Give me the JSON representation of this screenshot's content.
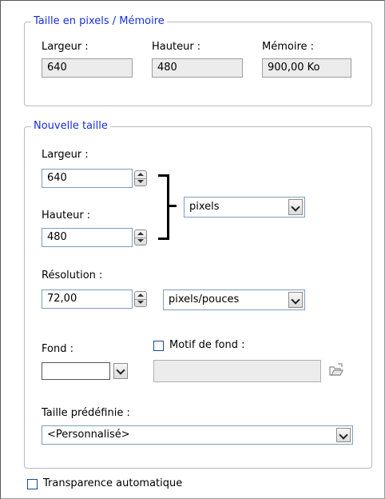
{
  "pixel_size": {
    "title": "Taille en pixels / Mémoire",
    "width_label": "Largeur :",
    "width_value": "640",
    "height_label": "Hauteur :",
    "height_value": "480",
    "memory_label": "Mémoire :",
    "memory_value": "900,00 Ko"
  },
  "new_size": {
    "title": "Nouvelle taille",
    "width_label": "Largeur :",
    "width_value": "640",
    "height_label": "Hauteur :",
    "height_value": "480",
    "unit_value": "pixels",
    "resolution_label": "Résolution :",
    "resolution_value": "72,00",
    "resolution_unit_value": "pixels/pouces",
    "background_label": "Fond :",
    "background_color": "#ffffff",
    "pattern_label": "Motif de fond :",
    "pattern_checked": false,
    "preset_label": "Taille prédéfinie :",
    "preset_value": "<Personnalisé>"
  },
  "auto_transparency": {
    "label": "Transparence automatique",
    "checked": false
  },
  "icons": {
    "spinner": "spinner-icon",
    "dropdown": "chevron-down-icon",
    "browse": "open-folder-icon"
  }
}
